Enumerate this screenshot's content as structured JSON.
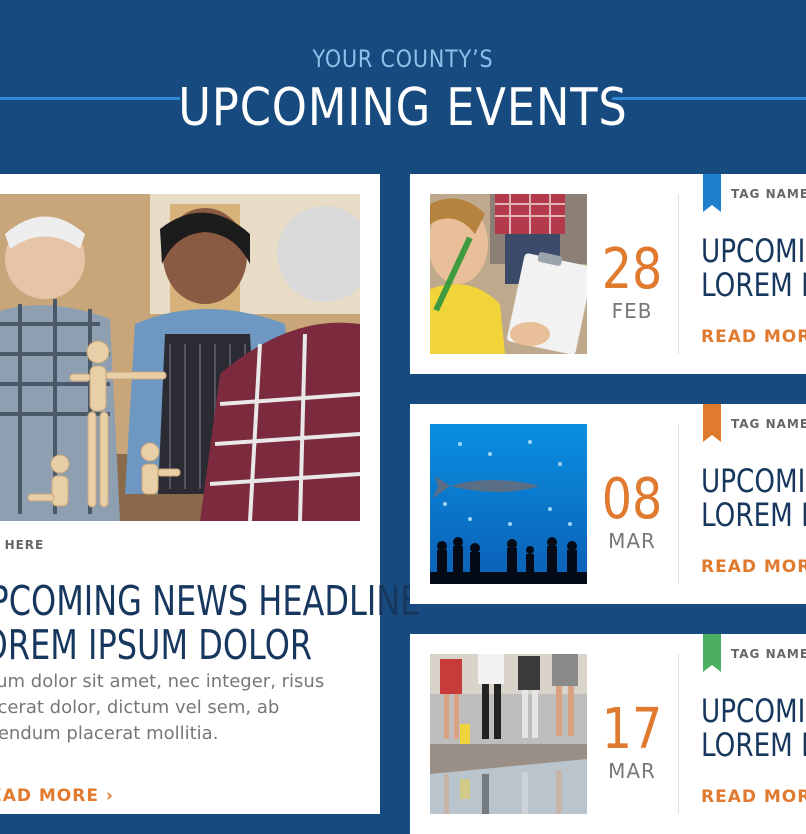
{
  "header": {
    "kicker": "YOUR COUNTY’S",
    "title": "UPCOMING EVENTS"
  },
  "feature": {
    "tag": "TAG HERE",
    "headline_line1": "UPCOMING NEWS HEADLINE",
    "headline_line2": "LOREM IPSUM DOLOR",
    "body_line1": "Ipsum dolor sit amet, nec integer, risus",
    "body_line2": "placerat dolor, dictum vel sem, ab",
    "body_line3": "bibendum placerat mollitia.",
    "read_more": "READ MORE",
    "read_more_arrow": "›"
  },
  "events": [
    {
      "day": "28",
      "month": "FEB",
      "tag": "TAG NAME",
      "headline_line1": "UPCOMING",
      "headline_line2": "LOREM IPSUM",
      "read_more": "READ MORE",
      "ribbon_color": "#1f7fcf",
      "image_icon": "child-with-clipboard-photo"
    },
    {
      "day": "08",
      "month": "MAR",
      "tag": "TAG NAME",
      "headline_line1": "UPCOMING",
      "headline_line2": "LOREM IPSUM",
      "read_more": "READ MORE",
      "ribbon_color": "#e07a2e",
      "image_icon": "aquarium-photo"
    },
    {
      "day": "17",
      "month": "MAR",
      "tag": "TAG NAME",
      "headline_line1": "UPCOMING",
      "headline_line2": "LOREM IPSUM",
      "read_more": "READ MORE",
      "ribbon_color": "#4cae60",
      "image_icon": "runners-photo"
    }
  ],
  "colors": {
    "background": "#174a7e",
    "accent": "#e07a2e",
    "headline": "#17375e",
    "rule": "#2d8ad8"
  }
}
